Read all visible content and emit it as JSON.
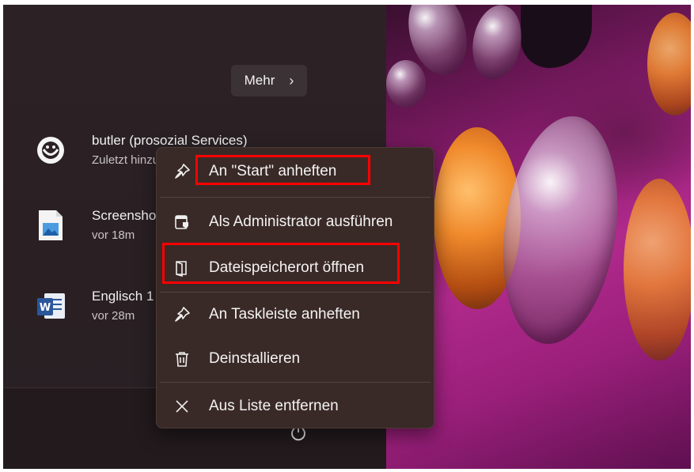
{
  "start_menu": {
    "more_button": {
      "label": "Mehr",
      "chevron": "›"
    },
    "recommended": [
      {
        "title": "butler (prosozial Services)",
        "subtitle": "Zuletzt hinzugefügt",
        "icon": "butler-app-icon"
      },
      {
        "title": "Screenshot",
        "subtitle": "vor 18m",
        "icon": "image-file-icon"
      },
      {
        "title": "Englisch 1",
        "subtitle": "vor 28m",
        "icon": "word-document-icon"
      }
    ],
    "power_icon": "power-icon"
  },
  "context_menu": {
    "items": [
      {
        "label": "An \"Start\" anheften",
        "icon": "pin-icon"
      },
      {
        "label": "Als Administrator ausführen",
        "icon": "admin-shield-icon"
      },
      {
        "label": "Dateispeicherort öffnen",
        "icon": "open-file-location-icon"
      },
      {
        "label": "An Taskleiste anheften",
        "icon": "pin-icon"
      },
      {
        "label": "Deinstallieren",
        "icon": "trash-icon"
      },
      {
        "label": "Aus Liste entfernen",
        "icon": "close-icon"
      }
    ]
  },
  "annotations": {
    "highlight_color": "#ff0000"
  }
}
